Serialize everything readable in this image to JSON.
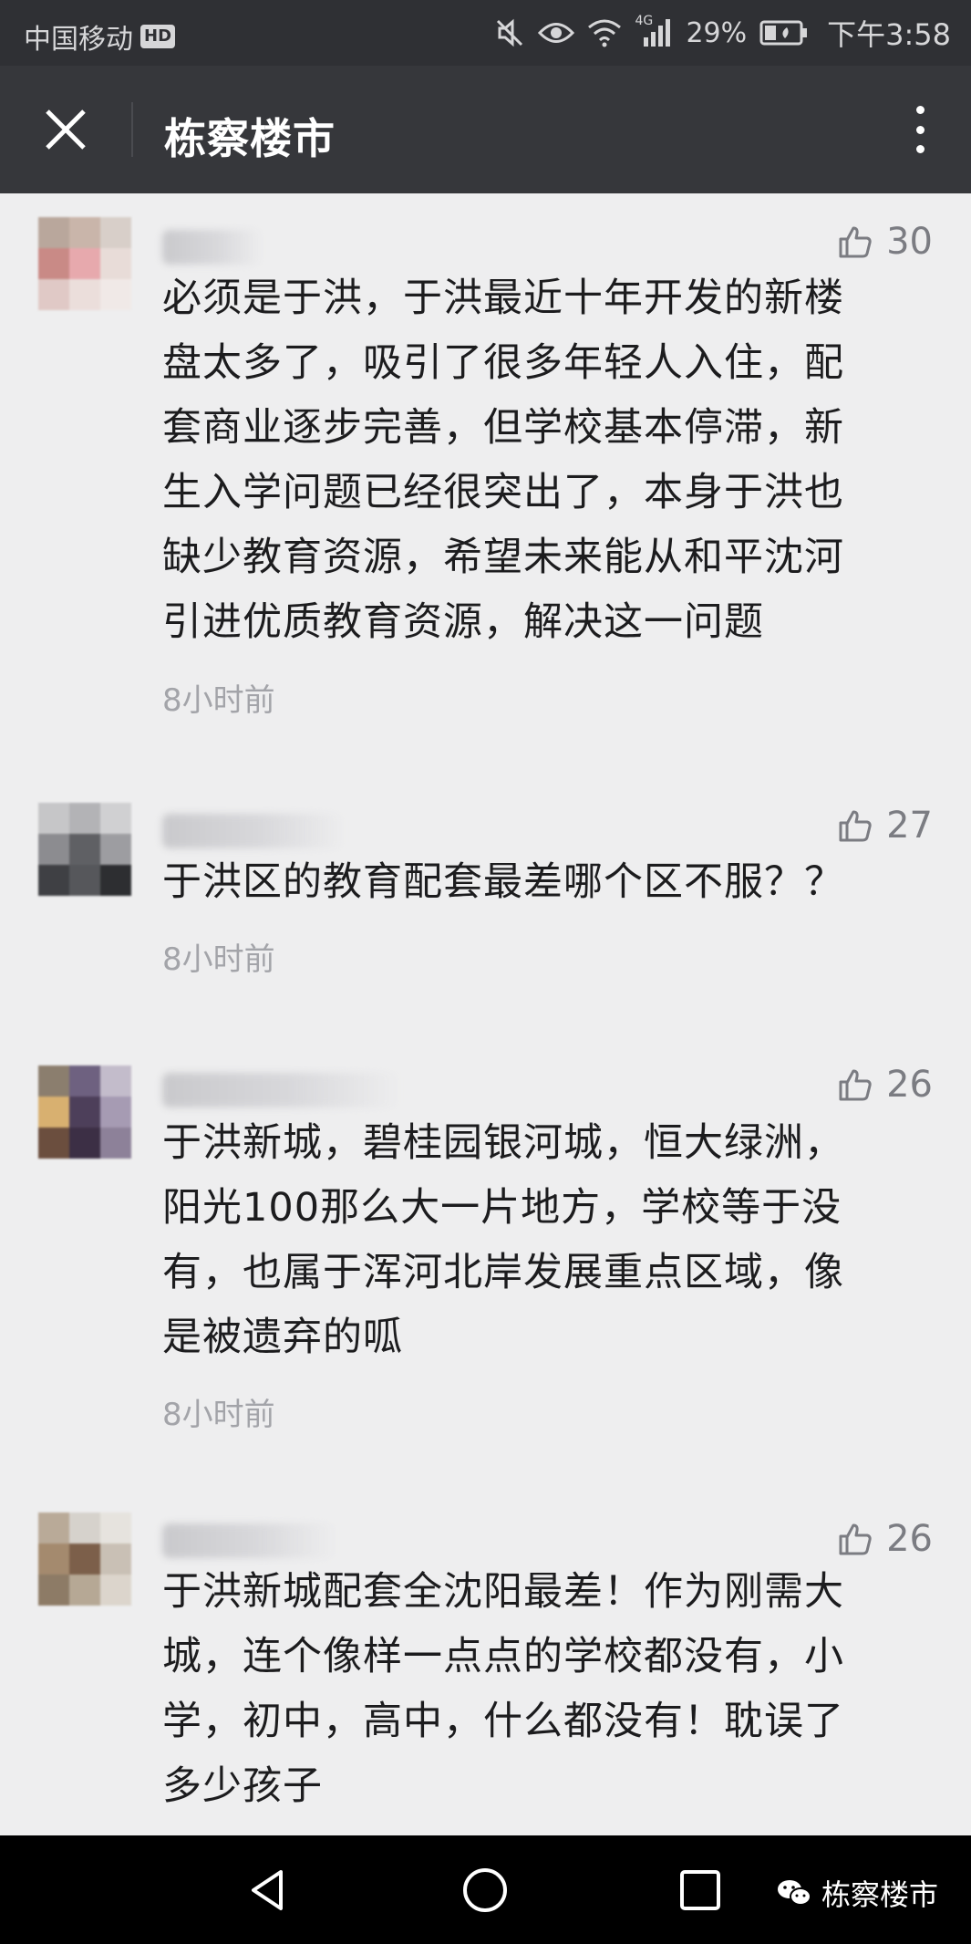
{
  "status_bar": {
    "carrier": "中国移动",
    "hd_badge": "HD",
    "network": "4G",
    "battery": "29%",
    "time": "下午3:58"
  },
  "header": {
    "title": "栋察楼市",
    "close_icon": "close-icon",
    "more_icon": "more-vertical-icon"
  },
  "comments": [
    {
      "likes": "30",
      "lines": [
        "必须是于洪，于洪最近十年开发的新楼",
        "盘太多了，吸引了很多年轻人入住，配",
        "套商业逐步完善，但学校基本停滞，新",
        "生入学问题已经很突出了，本身于洪也",
        "缺少教育资源，希望未来能从和平沈河",
        "引进优质教育资源，解决这一问题"
      ],
      "time": "8小时前"
    },
    {
      "likes": "27",
      "lines": [
        "于洪区的教育配套最差哪个区不服？？"
      ],
      "time": "8小时前"
    },
    {
      "likes": "26",
      "lines": [
        "于洪新城，碧桂园银河城，恒大绿洲，",
        "阳光100那么大一片地方，学校等于没",
        "有，也属于浑河北岸发展重点区域，像",
        "是被遗弃的呱"
      ],
      "time": "8小时前"
    },
    {
      "likes": "26",
      "lines": [
        "于洪新城配套全沈阳最差！作为刚需大",
        "城，连个像样一点点的学校都没有，小",
        "学，初中，高中，什么都没有！耽误了",
        "多少孩子"
      ],
      "time": ""
    }
  ],
  "nav_bar": {
    "back_icon": "back-triangle-icon",
    "home_icon": "home-circle-icon",
    "recent_icon": "recent-apps-icon"
  },
  "watermark": {
    "label": "栋察楼市",
    "icon": "wechat-icon"
  },
  "colors": {
    "status_bar": "#2f3034",
    "title_bar": "#36373b",
    "background": "#eeeeef",
    "text": "#1c1c1e",
    "meta": "#a3a4a9",
    "like": "#7b7c82"
  }
}
